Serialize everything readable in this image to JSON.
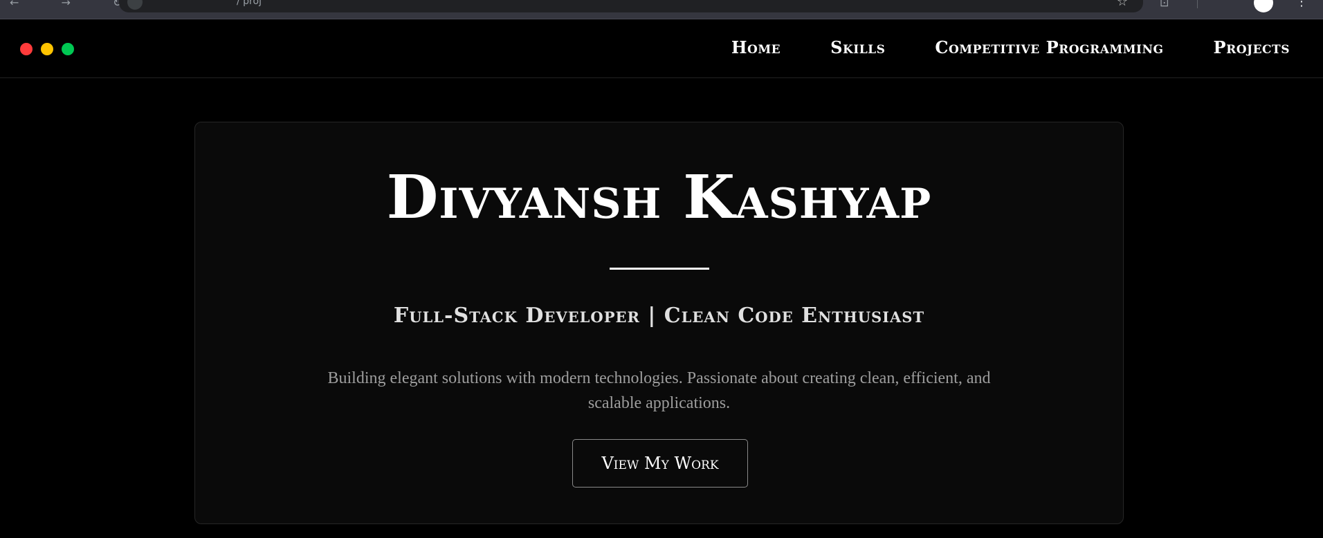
{
  "browser": {
    "nav_glyphs": "← → ↻",
    "url": "/ proj",
    "star": "☆",
    "right_glyphs": "⊡",
    "menu": "⋮"
  },
  "header": {
    "window_dots": {
      "red": "#ff3b3b",
      "yellow": "#ffc400",
      "green": "#00c853"
    },
    "nav": {
      "home": "Home",
      "skills": "Skills",
      "competitive_programming": "Competitive Programming",
      "projects": "Projects"
    }
  },
  "hero": {
    "name": "Divyansh Kashyap",
    "subtitle": "Full-Stack Developer | Clean Code Enthusiast",
    "description": "Building elegant solutions with modern technologies. Passionate about creating clean, efficient, and scalable applications.",
    "cta_label": "View My Work"
  },
  "colors": {
    "page_background": "#000000",
    "card_background": "#0a0a0a",
    "text_primary": "#ffffff",
    "text_muted": "#9e9e9e"
  }
}
